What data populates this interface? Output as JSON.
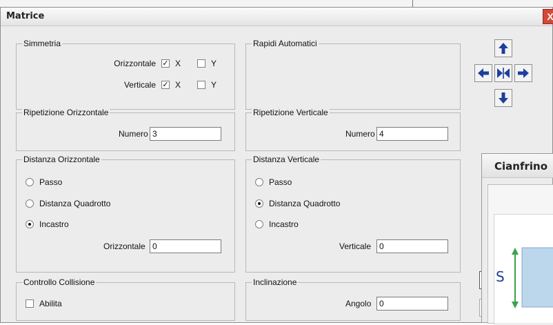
{
  "window": {
    "title": "Matrice",
    "close_label": "X"
  },
  "simmetria": {
    "legend": "Simmetria",
    "rows": [
      {
        "label": "Orizzontale",
        "x": {
          "label": "X",
          "checked": true
        },
        "y": {
          "label": "Y",
          "checked": false
        }
      },
      {
        "label": "Verticale",
        "x": {
          "label": "X",
          "checked": true
        },
        "y": {
          "label": "Y",
          "checked": false
        }
      }
    ]
  },
  "rapidi": {
    "legend": "Rapidi Automatici"
  },
  "ripetizione_orizzontale": {
    "legend": "Ripetizione Orizzontale",
    "numero_label": "Numero",
    "numero_value": "3"
  },
  "ripetizione_verticale": {
    "legend": "Ripetizione Verticale",
    "numero_label": "Numero",
    "numero_value": "4"
  },
  "distanza_orizzontale": {
    "legend": "Distanza Orizzontale",
    "options": [
      {
        "label": "Passo",
        "selected": false
      },
      {
        "label": "Distanza Quadrotto",
        "selected": false
      },
      {
        "label": "Incastro",
        "selected": true
      }
    ],
    "field_label": "Orizzontale",
    "field_value": "0"
  },
  "distanza_verticale": {
    "legend": "Distanza Verticale",
    "options": [
      {
        "label": "Passo",
        "selected": false
      },
      {
        "label": "Distanza Quadrotto",
        "selected": true
      },
      {
        "label": "Incastro",
        "selected": false
      }
    ],
    "field_label": "Verticale",
    "field_value": "0"
  },
  "controllo_collisione": {
    "legend": "Controllo Collisione",
    "abilita_label": "Abilita",
    "checked": false
  },
  "inclinazione": {
    "legend": "Inclinazione",
    "angolo_label": "Angolo",
    "angolo_value": "0"
  },
  "arrow_pad": {
    "icons": [
      "arrow-up-icon",
      "arrow-left-icon",
      "mirror-icon",
      "arrow-right-icon",
      "arrow-down-icon"
    ],
    "color": "#1c3f9e"
  },
  "background_window": {
    "title": "Cianfrino",
    "dimension_label": "S",
    "accent_color": "#3aa24a"
  }
}
